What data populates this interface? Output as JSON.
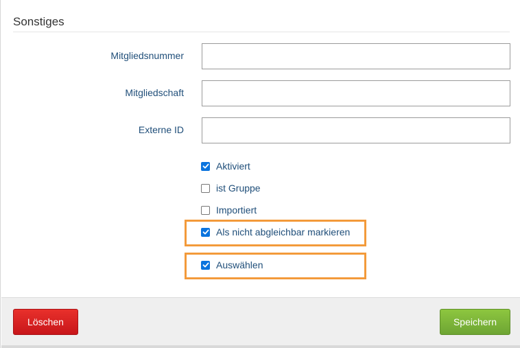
{
  "section": {
    "title": "Sonstiges"
  },
  "fields": {
    "mitgliedsnummer": {
      "label": "Mitgliedsnummer",
      "value": ""
    },
    "mitgliedschaft": {
      "label": "Mitgliedschaft",
      "value": ""
    },
    "externe_id": {
      "label": "Externe ID",
      "value": ""
    }
  },
  "checkboxes": {
    "aktiviert": {
      "label": "Aktiviert",
      "checked": true
    },
    "ist_gruppe": {
      "label": "ist Gruppe",
      "checked": false
    },
    "importiert": {
      "label": "Importiert",
      "checked": false
    },
    "nicht_abgleichbar": {
      "label": "Als nicht abgleichbar markieren",
      "checked": true
    },
    "auswaehlen": {
      "label": "Auswählen",
      "checked": true
    }
  },
  "footer": {
    "delete_label": "Löschen",
    "save_label": "Speichern"
  },
  "colors": {
    "highlight": "#f39a3a",
    "delete_button": "#d41f1f",
    "save_button": "#7cb63a",
    "checkbox_checked": "#0b74de",
    "label_text": "#1f4e79"
  }
}
